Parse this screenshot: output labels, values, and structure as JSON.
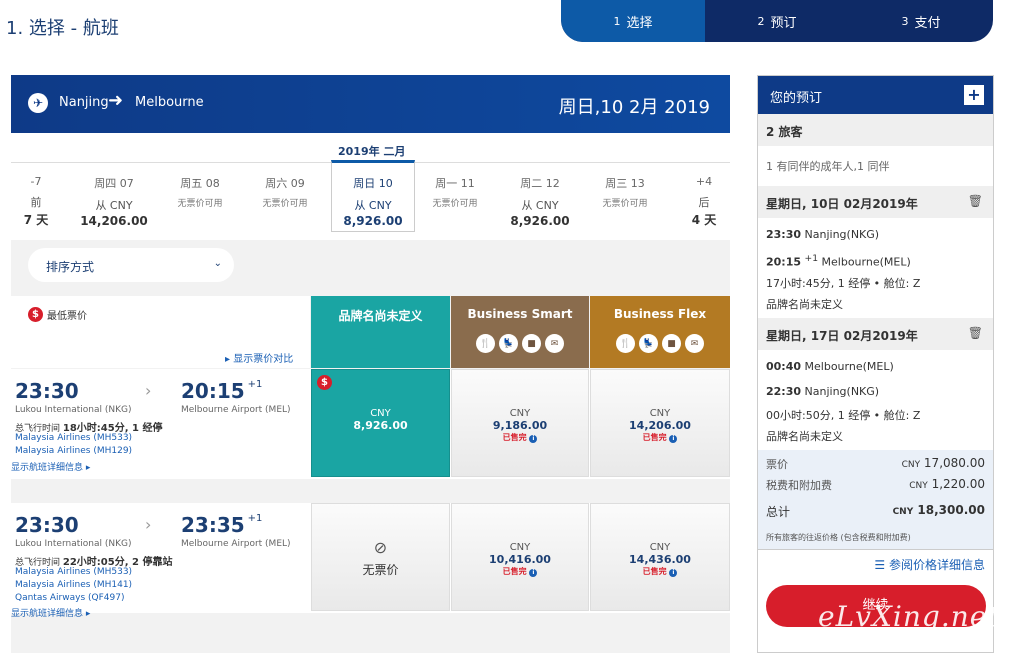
{
  "step_title": "1. 选择 - 航班",
  "steps": [
    {
      "num": "1",
      "label": "选择"
    },
    {
      "num": "2",
      "label": "预订"
    },
    {
      "num": "3",
      "label": "支付"
    }
  ],
  "flight_header": {
    "from": "Nanjing",
    "to": "Melbourne",
    "date": "周日,10 2月 2019"
  },
  "month_label": "2019年 二月",
  "calendar": [
    {
      "wd": "-7",
      "mid": "前",
      "price": "7 天"
    },
    {
      "wd": "周四 07",
      "mid": "从 CNY",
      "price": "14,206.00"
    },
    {
      "wd": "周五 08",
      "sub": "无票价可用"
    },
    {
      "wd": "周六 09",
      "sub": "无票价可用"
    },
    {
      "wd": "周日 10",
      "mid": "从 CNY",
      "price": "8,926.00"
    },
    {
      "wd": "周一 11",
      "sub": "无票价可用"
    },
    {
      "wd": "周二 12",
      "mid": "从 CNY",
      "price": "8,926.00"
    },
    {
      "wd": "周三 13",
      "sub": "无票价可用"
    },
    {
      "wd": "+4",
      "mid": "后",
      "price": "4 天"
    }
  ],
  "sort_label": "排序方式",
  "lowest_label": "最低票价",
  "compare_link": "▸ 显示票价对比",
  "columns": [
    {
      "title": "品牌名尚未定义"
    },
    {
      "title": "Business Smart"
    },
    {
      "title": "Business Flex"
    }
  ],
  "flights": [
    {
      "dep": "23:30",
      "arr": "20:15",
      "plus": "+1",
      "dep_airport": "Lukou International (NKG)",
      "arr_airport": "Melbourne Airport (MEL)",
      "dur_prefix": "总飞行时间 ",
      "dur": "18小时:45分",
      "stops": ", 1 经停",
      "airlines": [
        "Malaysia Airlines (MH533)",
        "Malaysia Airlines (MH129)"
      ],
      "details": "显示航班详细信息 ▸",
      "fares": [
        {
          "cny": "CNY",
          "amount": "8,926.00"
        },
        {
          "cny": "CNY",
          "amount": "9,186.00",
          "sold": "已售完"
        },
        {
          "cny": "CNY",
          "amount": "14,206.00",
          "sold": "已售完"
        }
      ]
    },
    {
      "dep": "23:30",
      "arr": "23:35",
      "plus": "+1",
      "dep_airport": "Lukou International (NKG)",
      "arr_airport": "Melbourne Airport (MEL)",
      "dur_prefix": "总飞行时间 ",
      "dur": "22小时:05分",
      "stops": ", 2 停靠站",
      "airlines": [
        "Malaysia Airlines (MH533)",
        "Malaysia Airlines (MH141)",
        "Qantas Airways (QF497)"
      ],
      "details": "显示航班详细信息 ▸",
      "fares": [
        {
          "noav": "无票价"
        },
        {
          "cny": "CNY",
          "amount": "10,416.00",
          "sold": "已售完"
        },
        {
          "cny": "CNY",
          "amount": "14,436.00",
          "sold": "已售完"
        }
      ]
    }
  ],
  "panel": {
    "title": "您的预订",
    "travelers": "2 旅客",
    "traveler_detail": "1 有同伴的成年人,1 同伴",
    "leg1": {
      "date": "星期日, 10日 02月2019年",
      "dep_time": "23:30",
      "dep": "Nanjing(NKG)",
      "arr_time": "20:15",
      "arr_plus": "+1",
      "arr": "Melbourne(MEL)",
      "info": "17小时:45分, 1 经停 • 舱位: Z",
      "brand": "品牌名尚未定义"
    },
    "leg2": {
      "date": "星期日, 17日 02月2019年",
      "dep_time": "00:40",
      "dep": "Melbourne(MEL)",
      "arr_time": "22:30",
      "arr": "Nanjing(NKG)",
      "info": "00小时:50分, 1 经停 • 舱位: Z",
      "brand": "品牌名尚未定义"
    },
    "fare_label": "票价",
    "fare_cur": "CNY",
    "fare_val": "17,080.00",
    "tax_label": "税费和附加费",
    "tax_cur": "CNY",
    "tax_val": "1,220.00",
    "total_label": "总计",
    "total_cur": "CNY",
    "total_val": "18,300.00",
    "note": "所有旅客的往返价格 (包含税费和附加费)",
    "detail_link": "参阅价格详细信息",
    "continue": "继续"
  },
  "watermark": "eLvXing.net"
}
